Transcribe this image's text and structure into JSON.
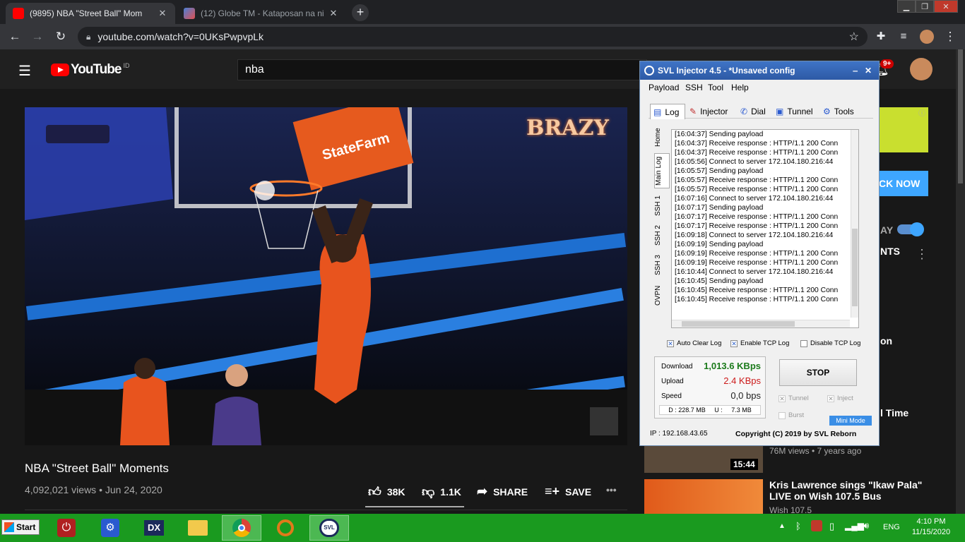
{
  "chrome": {
    "tabs": [
      {
        "title": "(9895) NBA \"Street Ball\" Mom",
        "active": true
      },
      {
        "title": "(12) Globe TM - Kataposan na ni",
        "active": false
      }
    ],
    "new_tab": "+",
    "url": "youtube.com/watch?v=0UKsPwpvpLk"
  },
  "youtube": {
    "logo": "YouTube",
    "logo_region": "ID",
    "search_value": "nba",
    "notification_badge": "9+",
    "video": {
      "title": "NBA \"Street Ball\" Moments",
      "views_date": "4,092,021 views • Jun 24, 2020",
      "likes": "38K",
      "dislikes": "1.1K",
      "share": "SHARE",
      "save": "SAVE",
      "more": "•••"
    },
    "overlay_text": {
      "brand": "BRAZY",
      "sponsor": "StateFarm"
    },
    "sidebar": {
      "ad_cta": "CK NOW",
      "autoplay_frag": "AY",
      "up_next_frag": "NTS",
      "item1_frag": "on",
      "item2_frag": "l Time",
      "item2_meta": "76M views • 7 years ago",
      "item2_duration": "15:44",
      "item3_title_line1": "Kris Lawrence sings \"Ikaw Pala\"",
      "item3_title_line2": "LIVE on Wish 107.5 Bus",
      "item3_channel": "Wish 107.5"
    }
  },
  "svl": {
    "title": "SVL Injector 4.5 - *Unsaved config",
    "menu": [
      "Payload",
      "SSH",
      "Tool",
      "Help"
    ],
    "tabs": [
      "Log",
      "Injector",
      "Dial",
      "Tunnel",
      "Tools"
    ],
    "side_tabs": [
      "Home",
      "Main Log",
      "SSH 1",
      "SSH 2",
      "SSH 3",
      "OVPN"
    ],
    "log": [
      "[16:04:37] Sending payload",
      "[16:04:37] Receive response : HTTP/1.1 200 Conn",
      "[16:04:37] Receive response : HTTP/1.1 200 Conn",
      "[16:05:56] Connect to server 172.104.180.216:44",
      "[16:05:57] Sending payload",
      "[16:05:57] Receive response : HTTP/1.1 200 Conn",
      "[16:05:57] Receive response : HTTP/1.1 200 Conn",
      "[16:07:16] Connect to server 172.104.180.216:44",
      "[16:07:17] Sending payload",
      "[16:07:17] Receive response : HTTP/1.1 200 Conn",
      "[16:07:17] Receive response : HTTP/1.1 200 Conn",
      "[16:09:18] Connect to server 172.104.180.216:44",
      "[16:09:19] Sending payload",
      "[16:09:19] Receive response : HTTP/1.1 200 Conn",
      "[16:09:19] Receive response : HTTP/1.1 200 Conn",
      "[16:10:44] Connect to server 172.104.180.216:44",
      "[16:10:45] Sending payload",
      "[16:10:45] Receive response : HTTP/1.1 200 Conn",
      "[16:10:45] Receive response : HTTP/1.1 200 Conn"
    ],
    "options": {
      "auto_clear": "Auto Clear Log",
      "enable_tcp": "Enable TCP Log",
      "disable_tcp": "Disable TCP Log"
    },
    "stats": {
      "download_label": "Download",
      "download_value": "1,013.6 KBps",
      "upload_label": "Upload",
      "upload_value": "2.4 KBps",
      "speed_label": "Speed",
      "speed_value": "0,0 bps",
      "totals": "D : 228.7 MB     U :     7.3 MB"
    },
    "stop": "STOP",
    "tunnel": "Tunnel",
    "inject": "Inject",
    "burst": "Burst",
    "mini_mode": "Mini Mode",
    "ip": "IP : 192.168.43.65",
    "copyright": "Copyright (C) 2019 by SVL Reborn"
  },
  "taskbar": {
    "start": "Start",
    "lang": "ENG",
    "time": "4:10 PM",
    "date": "11/15/2020"
  }
}
